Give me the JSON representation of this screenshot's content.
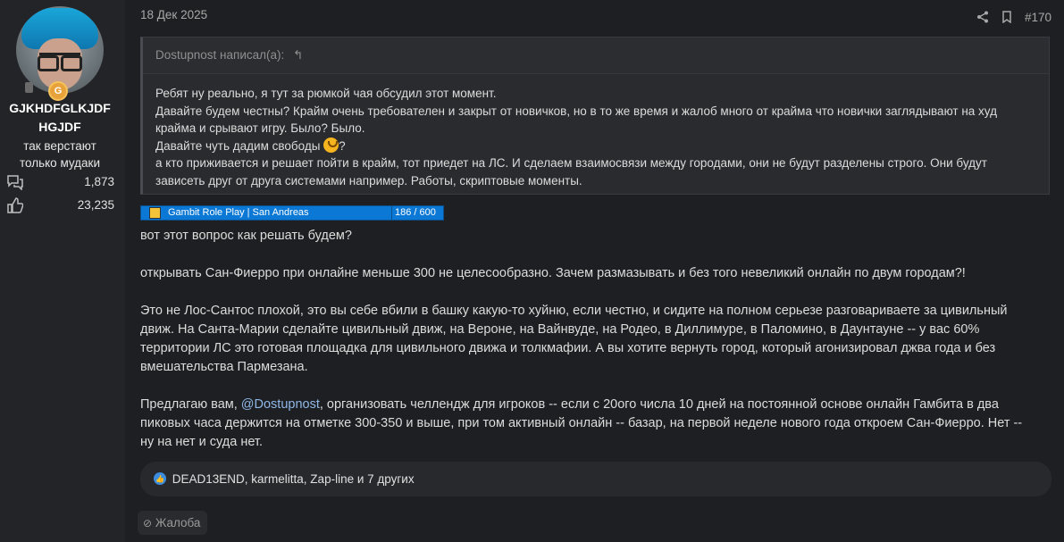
{
  "author": {
    "username_line1": "GJKHDFGLKJDF",
    "username_line2": "HGJDF",
    "title_line1": "так верстают",
    "title_line2": "только мудаки",
    "messages_count": "1,873",
    "reactions_count": "23,235"
  },
  "post": {
    "date": "18 Дек 2025",
    "number": "#170"
  },
  "quote": {
    "author_line": "Dostupnost написал(а):",
    "lines": [
      "Ребят ну реально, я тут за рюмкой чая обсудил этот момент.",
      "Давайте будем честны? Крайм очень требователен и закрыт от новичков, но в то же время и жалоб много от крайма что новички заглядывают на худ",
      "крайма и срывают игру. Было? Было.",
      "Давайте чуть дадим свободы",
      "?",
      "а кто приживается и решает пойти в крайм, тот приедет на ЛС. И сделаем взаимосвязи между городами, они не будут разделены строго. Они будут",
      "зависеть друг от друга системами например. Работы, скриптовые моменты."
    ]
  },
  "signature": {
    "server_name": "Gambit Role Play | San Andreas",
    "online": "186 / 600"
  },
  "content": {
    "p1": "вот этот вопрос как решать будем?",
    "p2": "открывать Сан-Фиерро при онлайне меньше 300 не целесообразно. Зачем размазывать и без того невеликий онлайн по двум городам?!",
    "p3_l1": "Это не Лос-Сантос плохой, это вы себе вбили в башку какую-то хуйню, если честно, и сидите на полном серьезе разговариваете за цивильный",
    "p3_l2": "движ. На Санта-Марии сделайте цивильный движ, на Вероне, на Вайнвуде, на Родео, в Диллимуре, в Паломино, в Даунтауне -- у вас 60%",
    "p3_l3": "территории ЛС это готовая площадка для цивильного движа и толкмафии. А вы хотите вернуть город, который агонизировал джва года и без",
    "p3_l4": "вмешательства Пармезана.",
    "p4_pre": "Предлагаю вам, ",
    "p4_mention": "@Dostupnost",
    "p4_l1_rest": ", организовать челлендж для игроков -- если с 20ого числа 10 дней на постоянной основе онлайн Гамбита в два",
    "p4_l2": "пиковых часа держится на отметке 300-350 и выше, при том активный онлайн -- базар, на первой неделе нового года откроем Сан-Фиерро. Нет --",
    "p4_l3": "ну на нет и суда нет."
  },
  "reactions": {
    "text": "DEAD13END, karmelitta, Zap-line и 7 других"
  },
  "report": {
    "label": "Жалоба"
  },
  "colors": {
    "background": "#1e1f22",
    "accent": "#0a78d4",
    "mention": "#8fb8e8"
  },
  "icons": [
    "share-icon",
    "bookmark-icon",
    "reply-arrow-icon",
    "messages-icon",
    "like-icon",
    "warning-icon",
    "lock-icon"
  ]
}
